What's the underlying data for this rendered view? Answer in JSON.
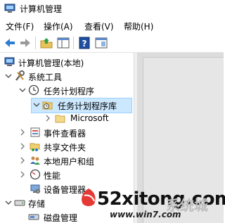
{
  "window": {
    "title": "计算机管理"
  },
  "menu": [
    {
      "label": "文件(F)"
    },
    {
      "label": "操作(A)"
    },
    {
      "label": "查看(V)"
    },
    {
      "label": "帮助(H)"
    }
  ],
  "toolbar": {
    "buttons": [
      "back-arrow-icon",
      "forward-arrow-icon",
      "up-folder-icon",
      "show-hide-tree-icon",
      "help-icon",
      "properties-icon"
    ]
  },
  "tree": [
    {
      "label": "计算机管理(本地)",
      "icon": "computer-management-icon",
      "chevron": "none"
    },
    {
      "label": "系统工具",
      "icon": "tools-icon",
      "chevron": "down"
    },
    {
      "label": "任务计划程序",
      "icon": "clock-icon",
      "chevron": "down"
    },
    {
      "label": "任务计划程序库",
      "icon": "folder-clock-icon",
      "chevron": "down",
      "selected": true
    },
    {
      "label": "Microsoft",
      "icon": "folder-icon",
      "chevron": "right"
    },
    {
      "label": "事件查看器",
      "icon": "event-viewer-icon",
      "chevron": "right"
    },
    {
      "label": "共享文件夹",
      "icon": "shared-folder-icon",
      "chevron": "right"
    },
    {
      "label": "本地用户和组",
      "icon": "users-icon",
      "chevron": "right"
    },
    {
      "label": "性能",
      "icon": "performance-icon",
      "chevron": "right"
    },
    {
      "label": "设备管理器",
      "icon": "device-manager-icon",
      "chevron": "none"
    },
    {
      "label": "存储",
      "icon": "storage-icon",
      "chevron": "down"
    },
    {
      "label": "磁盘管理",
      "icon": "disk-management-icon",
      "chevron": "none"
    }
  ],
  "watermark": {
    "text": "52xitong.com",
    "cn": "系统城",
    "url": "www.win7.com"
  }
}
